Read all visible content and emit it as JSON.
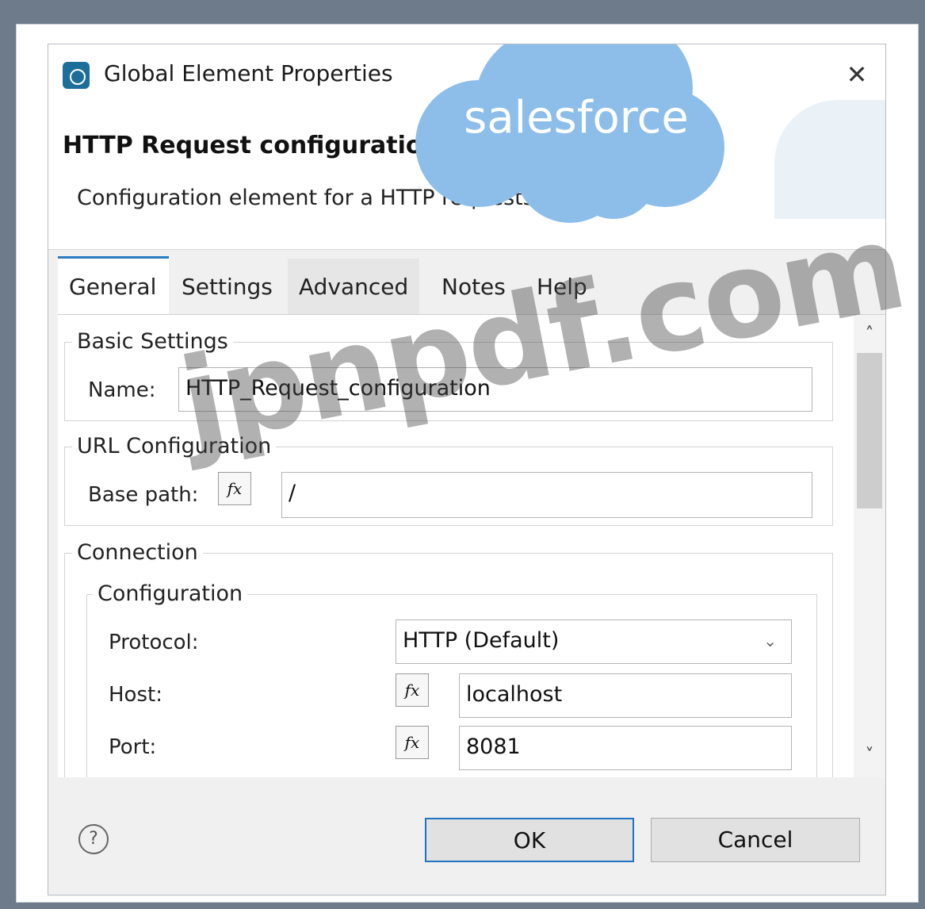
{
  "dialog": {
    "title": "Global Element Properties",
    "subtitle": "HTTP Request configuration",
    "description": "Configuration element for a HTTP requests.",
    "close_icon": "close-icon"
  },
  "brand": {
    "text": "salesforce",
    "color": "#8dbee9"
  },
  "tabs": [
    "General",
    "Settings",
    "Advanced",
    "Notes",
    "Help"
  ],
  "general": {
    "basic_settings": {
      "title": "Basic Settings",
      "name_label": "Name:",
      "name_value": "HTTP_Request_configuration"
    },
    "url_configuration": {
      "title": "URL Configuration",
      "base_path_label": "Base path:",
      "base_path_value": "/"
    },
    "connection": {
      "title": "Connection",
      "configuration_title": "Configuration",
      "protocol_label": "Protocol:",
      "protocol_value": "HTTP (Default)",
      "host_label": "Host:",
      "host_value": "localhost",
      "port_label": "Port:",
      "port_value": "8081"
    },
    "fx_label": "fx"
  },
  "footer": {
    "ok": "OK",
    "cancel": "Cancel",
    "help_icon": "?"
  },
  "watermark": "jpnpdf.com",
  "colors": {
    "accent": "#1f73c5",
    "background": "#6e7b8b"
  }
}
